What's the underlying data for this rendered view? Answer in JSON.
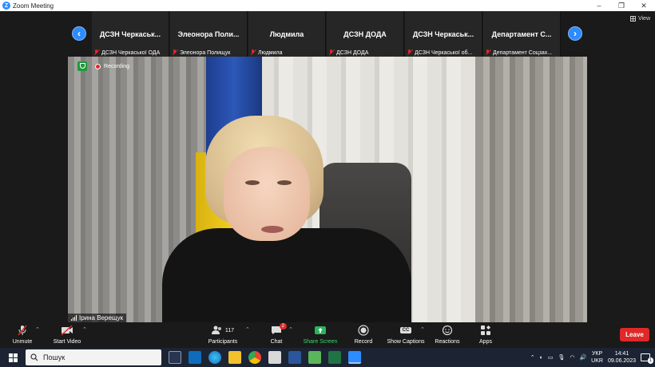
{
  "window": {
    "title": "Zoom Meeting",
    "minimize": "–",
    "maximize": "❐",
    "close": "✕"
  },
  "gallery": {
    "view_label": "View",
    "tiles": [
      {
        "name": "ДСЗН  Черкаськ...",
        "label": "ДСЗН Черкаської ОДА"
      },
      {
        "name": "Элеонора  Поли...",
        "label": "Элеонора Полищук"
      },
      {
        "name": "Людмила",
        "label": "Людмила"
      },
      {
        "name": "ДСЗН  ДОДА",
        "label": "ДСЗН ДОДА"
      },
      {
        "name": "ДСЗН  Черкаськ...",
        "label": "ДСЗН Черкаської об..."
      },
      {
        "name": "Департамент  С...",
        "label": "Департамент Соцзах..."
      }
    ]
  },
  "video": {
    "recording_label": "Recording",
    "speaker_name": "Ірина Верещук"
  },
  "toolbar": {
    "unmute": "Unmute",
    "start_video": "Start Video",
    "participants": "Participants",
    "participants_count": "117",
    "chat": "Chat",
    "chat_badge": "2",
    "share_screen": "Share Screen",
    "record": "Record",
    "show_captions": "Show Captions",
    "cc": "CC",
    "reactions": "Reactions",
    "apps": "Apps",
    "leave": "Leave"
  },
  "taskbar": {
    "search_placeholder": "Пошук",
    "lang_top": "УКР",
    "lang_bottom": "UKR",
    "time": "14:41",
    "date": "09.06.2023",
    "notification_count": "1"
  },
  "colors": {
    "zoom_blue": "#2d8cff",
    "leave_red": "#e02828",
    "share_green": "#38d86b",
    "recording_shield": "#1c9b3a"
  }
}
